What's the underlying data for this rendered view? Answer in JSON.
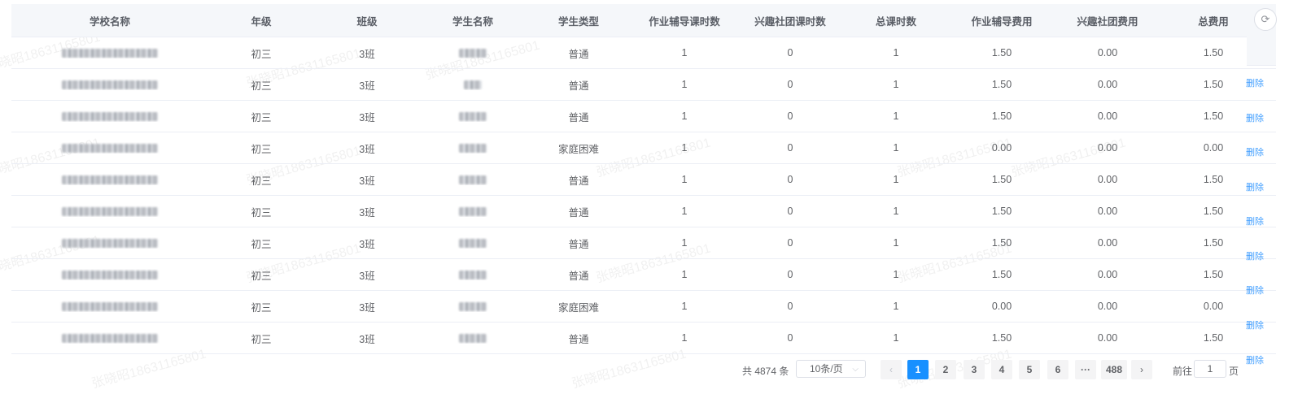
{
  "table": {
    "headers": [
      "学校名称",
      "年级",
      "班级",
      "学生名称",
      "学生类型",
      "作业辅导课时数",
      "兴趣社团课时数",
      "总课时数",
      "作业辅导费用",
      "兴趣社团费用",
      "总费用"
    ],
    "rows": [
      {
        "grade": "初三",
        "class": "3班",
        "type": "普通",
        "homework_hours": "1",
        "club_hours": "0",
        "total_hours": "1",
        "homework_fee": "1.50",
        "club_fee": "0.00",
        "total_fee": "1.50"
      },
      {
        "grade": "初三",
        "class": "3班",
        "type": "普通",
        "homework_hours": "1",
        "club_hours": "0",
        "total_hours": "1",
        "homework_fee": "1.50",
        "club_fee": "0.00",
        "total_fee": "1.50"
      },
      {
        "grade": "初三",
        "class": "3班",
        "type": "普通",
        "homework_hours": "1",
        "club_hours": "0",
        "total_hours": "1",
        "homework_fee": "1.50",
        "club_fee": "0.00",
        "total_fee": "1.50"
      },
      {
        "grade": "初三",
        "class": "3班",
        "type": "家庭困难",
        "homework_hours": "1",
        "club_hours": "0",
        "total_hours": "1",
        "homework_fee": "0.00",
        "club_fee": "0.00",
        "total_fee": "0.00"
      },
      {
        "grade": "初三",
        "class": "3班",
        "type": "普通",
        "homework_hours": "1",
        "club_hours": "0",
        "total_hours": "1",
        "homework_fee": "1.50",
        "club_fee": "0.00",
        "total_fee": "1.50"
      },
      {
        "grade": "初三",
        "class": "3班",
        "type": "普通",
        "homework_hours": "1",
        "club_hours": "0",
        "total_hours": "1",
        "homework_fee": "1.50",
        "club_fee": "0.00",
        "total_fee": "1.50"
      },
      {
        "grade": "初三",
        "class": "3班",
        "type": "普通",
        "homework_hours": "1",
        "club_hours": "0",
        "total_hours": "1",
        "homework_fee": "1.50",
        "club_fee": "0.00",
        "total_fee": "1.50"
      },
      {
        "grade": "初三",
        "class": "3班",
        "type": "普通",
        "homework_hours": "1",
        "club_hours": "0",
        "total_hours": "1",
        "homework_fee": "1.50",
        "club_fee": "0.00",
        "total_fee": "1.50"
      },
      {
        "grade": "初三",
        "class": "3班",
        "type": "家庭困难",
        "homework_hours": "1",
        "club_hours": "0",
        "total_hours": "1",
        "homework_fee": "0.00",
        "club_fee": "0.00",
        "total_fee": "0.00"
      },
      {
        "grade": "初三",
        "class": "3班",
        "type": "普通",
        "homework_hours": "1",
        "club_hours": "0",
        "total_hours": "1",
        "homework_fee": "1.50",
        "club_fee": "0.00",
        "total_fee": "1.50"
      }
    ]
  },
  "side": {
    "refresh_icon": "refresh-icon",
    "delete_label": "删除"
  },
  "pagination": {
    "total_text": "共 4874 条",
    "page_size": "10条/页",
    "pages": [
      "1",
      "2",
      "3",
      "4",
      "5",
      "6"
    ],
    "ellipsis": "···",
    "last_page": "488",
    "current_page": "1",
    "prev_icon": "chevron-left-icon",
    "next_icon": "chevron-right-icon",
    "goto_label": "前往",
    "goto_value": "1",
    "goto_unit": "页"
  },
  "watermark": "张晓昭18631165801",
  "colors": {
    "accent": "#1890ff",
    "link": "#409eff",
    "header_bg": "#f5f7fa"
  }
}
